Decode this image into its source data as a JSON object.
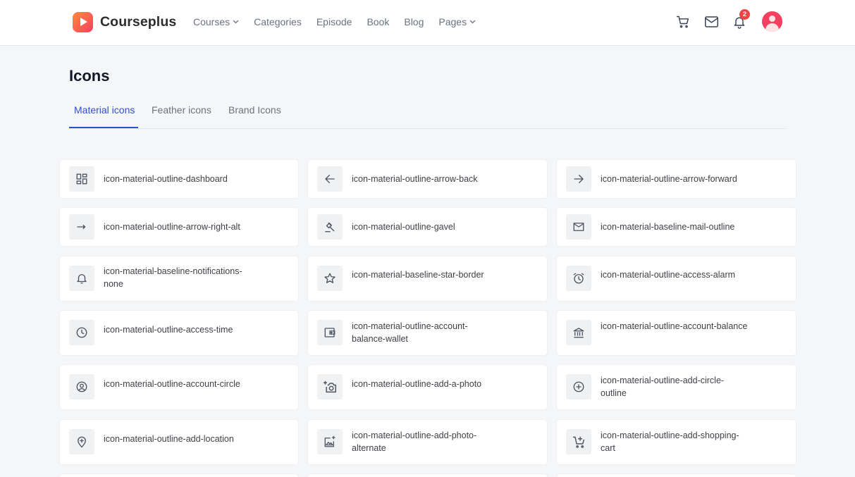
{
  "brand": {
    "name": "Courseplus"
  },
  "nav": [
    {
      "label": "Courses",
      "dropdown": true
    },
    {
      "label": "Categories",
      "dropdown": false
    },
    {
      "label": "Episode",
      "dropdown": false
    },
    {
      "label": "Book",
      "dropdown": false
    },
    {
      "label": "Blog",
      "dropdown": false
    },
    {
      "label": "Pages",
      "dropdown": true
    }
  ],
  "header": {
    "notification_count": "2"
  },
  "page": {
    "title": "Icons"
  },
  "tabs": [
    {
      "label": "Material icons",
      "active": true
    },
    {
      "label": "Feather icons",
      "active": false
    },
    {
      "label": "Brand Icons",
      "active": false
    }
  ],
  "icons": [
    {
      "label": "icon-material-outline-dashboard",
      "icon": "dashboard-icon"
    },
    {
      "label": "icon-material-outline-arrow-back",
      "icon": "arrow-back-icon"
    },
    {
      "label": "icon-material-outline-arrow-forward",
      "icon": "arrow-forward-icon"
    },
    {
      "label": "icon-material-outline-arrow-right-alt",
      "icon": "arrow-right-alt-icon"
    },
    {
      "label": "icon-material-outline-gavel",
      "icon": "gavel-icon"
    },
    {
      "label": "icon-material-baseline-mail-outline",
      "icon": "mail-icon"
    },
    {
      "label": "icon-material-baseline-notifications-none",
      "icon": "bell-icon"
    },
    {
      "label": "icon-material-baseline-star-border",
      "icon": "star-icon"
    },
    {
      "label": "icon-material-outline-access-alarm",
      "icon": "alarm-icon"
    },
    {
      "label": "icon-material-outline-access-time",
      "icon": "clock-icon"
    },
    {
      "label": "icon-material-outline-account-balance-wallet",
      "icon": "wallet-icon"
    },
    {
      "label": "icon-material-outline-account-balance",
      "icon": "bank-icon"
    },
    {
      "label": "icon-material-outline-account-circle",
      "icon": "account-circle-icon"
    },
    {
      "label": "icon-material-outline-add-a-photo",
      "icon": "add-photo-icon"
    },
    {
      "label": "icon-material-outline-add-circle-outline",
      "icon": "add-circle-icon"
    },
    {
      "label": "icon-material-outline-add-location",
      "icon": "add-location-icon"
    },
    {
      "label": "icon-material-outline-add-photo-alternate",
      "icon": "add-photo-alternate-icon"
    },
    {
      "label": "icon-material-outline-add-shopping-cart",
      "icon": "add-cart-icon"
    }
  ]
}
